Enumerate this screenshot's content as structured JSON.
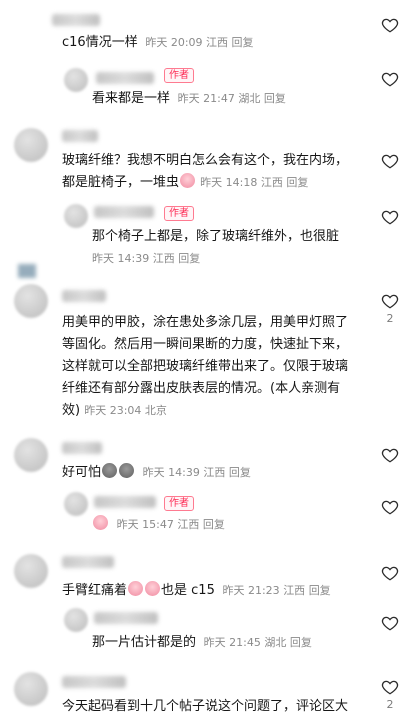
{
  "comments": [
    {
      "name": "c1",
      "text": "c16情况一样",
      "time": "昨天 20:09",
      "region": "江西",
      "reply": "回复",
      "likes": ""
    },
    {
      "name": "r1",
      "text": "看来都是一样",
      "time": "昨天 21:47",
      "region": "湖北",
      "reply": "回复",
      "author_badge": "作者",
      "likes": ""
    },
    {
      "name": "c2",
      "line1": "玻璃纤维？我想不明白怎么会有这个，我在内场，",
      "line2": "都是脏椅子，一堆虫",
      "time": "昨天 14:18",
      "region": "江西",
      "reply": "回复",
      "likes": ""
    },
    {
      "name": "r2",
      "text": "那个椅子上都是，除了玻璃纤维外，也很脏",
      "time": "昨天 14:39",
      "region": "江西",
      "reply": "回复",
      "author_badge": "作者",
      "likes": ""
    },
    {
      "name": "c3",
      "line1": "用美甲的甲胶，涂在患处多涂几层，用美甲灯照了",
      "line2": "等固化。然后用一瞬间果断的力度，快速扯下来，",
      "line3": "这样就可以全部把玻璃纤维带出来了。仅限于玻璃",
      "line4": "纤维还有部分露出皮肤表层的情况。(本人亲测有",
      "line5": "效)",
      "time": "昨天 23:04",
      "region": "北京",
      "reply": "",
      "likes": "2"
    },
    {
      "name": "c4",
      "text": "好可怕",
      "time": "昨天 14:39",
      "region": "江西",
      "reply": "回复",
      "likes": ""
    },
    {
      "name": "r4",
      "text": "",
      "time": "昨天 15:47",
      "region": "江西",
      "reply": "回复",
      "author_badge": "作者",
      "likes": ""
    },
    {
      "name": "c5",
      "text": "手臂红痛着",
      "text2": "也是 c15",
      "time": "昨天 21:23",
      "region": "江西",
      "reply": "回复",
      "likes": ""
    },
    {
      "name": "r5",
      "text": "那一片估计都是的",
      "time": "昨天 21:45",
      "region": "湖北",
      "reply": "回复",
      "likes": ""
    },
    {
      "name": "c6",
      "text": "今天起码看到十几个帖子说这个问题了，评论区大",
      "likes": "2"
    }
  ],
  "colors": {
    "accent": "#fe2c55",
    "meta": "#8a8a8a"
  },
  "icons": {
    "like": "heart-outline-icon",
    "emoji_pink": "crying-face-emoji",
    "emoji_gray": "poop-emoji"
  }
}
